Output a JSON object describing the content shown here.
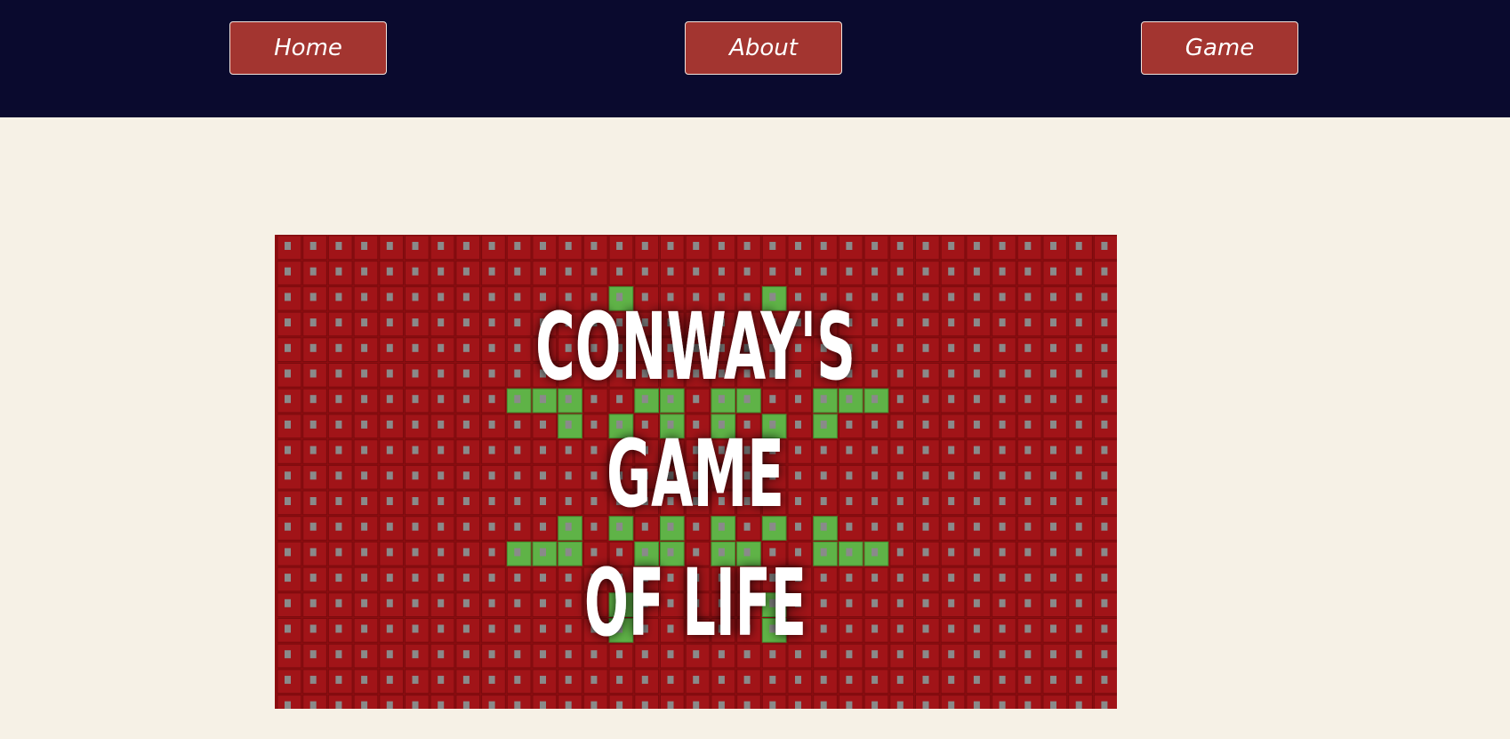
{
  "nav": {
    "home_label": "Home",
    "about_label": "About",
    "game_label": "Game"
  },
  "hero": {
    "title_line1": "CONWAY'S",
    "title_line2": "GAME",
    "title_line3": "OF LIFE",
    "grid_color": "#a11418",
    "live_cell_color": "#5fb347",
    "title_color": "#ffffff"
  },
  "colors": {
    "navbar_bg": "#0a0a2e",
    "button_bg": "#a33530",
    "page_bg": "#f6f1e6"
  }
}
